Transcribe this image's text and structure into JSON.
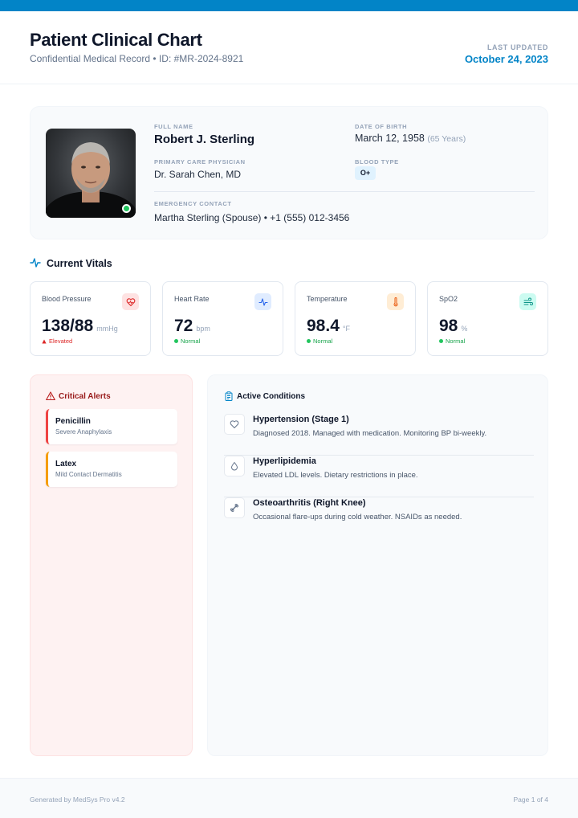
{
  "header": {
    "title": "Patient Clinical Chart",
    "subtitle": "Confidential Medical Record • ID: #MR-2024-8921",
    "updated_label": "LAST UPDATED",
    "updated_value": "October 24, 2023"
  },
  "patient": {
    "full_name_label": "FULL NAME",
    "full_name": "Robert J. Sterling",
    "dob_label": "DATE OF BIRTH",
    "dob": "March 12, 1958",
    "age": "(65 Years)",
    "pcp_label": "PRIMARY CARE PHYSICIAN",
    "pcp": "Dr. Sarah Chen, MD",
    "blood_label": "BLOOD TYPE",
    "blood": "O+",
    "emergency_label": "EMERGENCY CONTACT",
    "emergency": "Martha Sterling (Spouse) • +1 (555) 012-3456"
  },
  "vitals": {
    "title": "Current Vitals",
    "items": [
      {
        "label": "Blood Pressure",
        "value": "138/88",
        "unit": "mmHg",
        "status": "Elevated",
        "icon": "heart-icon",
        "color": "#dc2626"
      },
      {
        "label": "Heart Rate",
        "value": "72",
        "unit": "bpm",
        "status": "Normal",
        "icon": "pulse-icon",
        "color": "#16a34a"
      },
      {
        "label": "Temperature",
        "value": "98.4",
        "unit": "°F",
        "status": "Normal",
        "icon": "thermometer-icon",
        "color": "#16a34a"
      },
      {
        "label": "SpO2",
        "value": "98",
        "unit": "%",
        "status": "Normal",
        "icon": "wind-icon",
        "color": "#16a34a"
      }
    ]
  },
  "alerts": {
    "title": "Critical Alerts",
    "items": [
      {
        "name": "Penicillin",
        "desc": "Severe Anaphylaxis"
      },
      {
        "name": "Latex",
        "desc": "Mild Contact Dermatitis"
      }
    ]
  },
  "conditions": {
    "title": "Active Conditions",
    "items": [
      {
        "name": "Hypertension (Stage 1)",
        "desc": "Diagnosed 2018. Managed with medication. Monitoring BP bi-weekly.",
        "icon": "heart-outline-icon"
      },
      {
        "name": "Hyperlipidemia",
        "desc": "Elevated LDL levels. Dietary restrictions in place.",
        "icon": "droplet-icon"
      },
      {
        "name": "Osteoarthritis (Right Knee)",
        "desc": "Occasional flare-ups during cold weather. NSAIDs as needed.",
        "icon": "bone-icon"
      }
    ]
  },
  "footer": {
    "left": "Generated by MedSys Pro v4.2",
    "right": "Page 1 of 4"
  }
}
